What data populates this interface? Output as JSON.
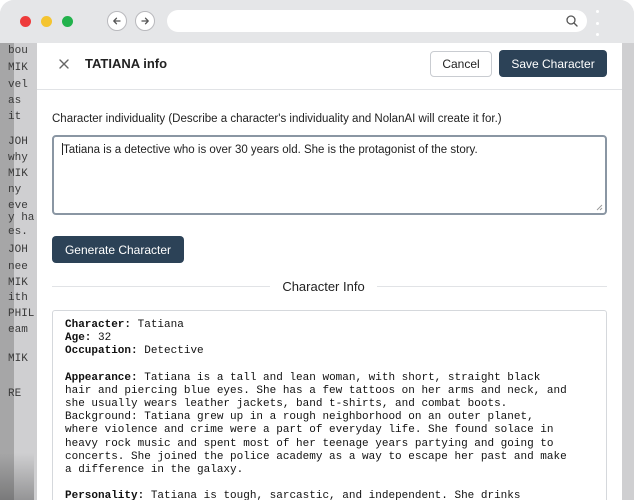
{
  "browser": {
    "url": ""
  },
  "background_script": {
    "lines": [
      "bou",
      "MIK",
      "vel",
      "as",
      "it",
      "JOH",
      "why",
      "MIK",
      "ny",
      "eve",
      "y ha",
      "es.",
      "JOH",
      "nee",
      "MIK",
      "ith",
      "PHIL",
      "eam",
      "MIK",
      "RE"
    ]
  },
  "modal": {
    "title": "TATIANA info",
    "cancel_label": "Cancel",
    "save_label": "Save Character",
    "description_label": "Character individuality (Describe a character's individuality and NolanAI will create it for.)",
    "description_value": "Tatiana is a detective who is over 30 years old. She is the protagonist of the story.",
    "generate_label": "Generate Character",
    "section_title": "Character Info",
    "info": {
      "character_key": "Character:",
      "character_value": "Tatiana",
      "age_key": "Age:",
      "age_value": "32",
      "occupation_key": "Occupation:",
      "occupation_value": "Detective",
      "appearance_key": "Appearance:",
      "appearance_lines": [
        "Tatiana is a tall and lean woman, with short, straight black",
        "hair and piercing blue eyes. She has a few tattoos on her arms and neck, and",
        "she usually wears leather jackets, band t-shirts, and combat boots.",
        "Background: Tatiana grew up in a rough neighborhood on an outer planet,",
        "where violence and crime were a part of everyday life. She found solace in",
        "heavy rock music and spent most of her teenage years partying and going to",
        "concerts. She joined the police academy as a way to escape her past and make",
        "a difference in the galaxy."
      ],
      "personality_key": "Personality:",
      "personality_value": "Tatiana is tough, sarcastic, and independent. She drinks"
    }
  },
  "colors": {
    "primary_button": "#2c4257",
    "close_dot": "#ee3b3b",
    "minimize_dot": "#f4c430",
    "maximize_dot": "#22b24c"
  }
}
